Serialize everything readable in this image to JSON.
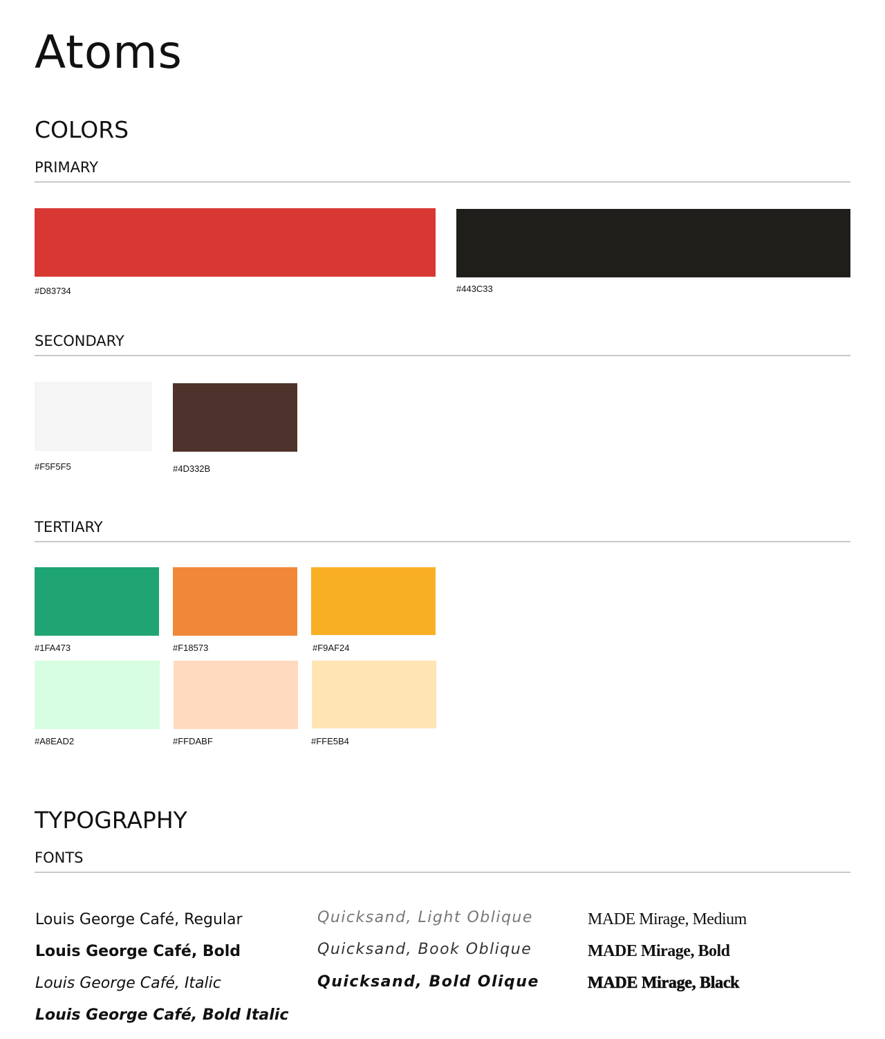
{
  "page": {
    "title": "Atoms"
  },
  "colors": {
    "heading": "COLORS",
    "primary": {
      "label": "PRIMARY",
      "swatches": [
        {
          "hex": "#D83734",
          "color": "#D83734"
        },
        {
          "hex": "#443C33",
          "color": "#201E1A"
        }
      ]
    },
    "secondary": {
      "label": "SECONDARY",
      "swatches": [
        {
          "hex": "#F5F5F5",
          "color": "#F5F5F5"
        },
        {
          "hex": "#4D332B",
          "color": "#4D332B"
        }
      ]
    },
    "tertiary": {
      "label": "TERTIARY",
      "swatches": [
        {
          "hex": "#1FA473",
          "color": "#1FA473"
        },
        {
          "hex": "#F18573",
          "color": "#F18739"
        },
        {
          "hex": "#F9AF24",
          "color": "#F9AF24"
        },
        {
          "hex": "#A8EAD2",
          "color": "#D7FEE0"
        },
        {
          "hex": "#FFDABF",
          "color": "#FFDABF"
        },
        {
          "hex": "#FFE5B4",
          "color": "#FFE5B4"
        }
      ]
    }
  },
  "typography": {
    "heading": "TYPOGRAPHY",
    "fonts_label": "FONTS",
    "louis_george": [
      "Louis George Café, Regular",
      "Louis George Café, Bold",
      "Louis George Café, Italic",
      "Louis George Café, Bold Italic"
    ],
    "quicksand": [
      "Quicksand, Light Oblique",
      "Quicksand, Book Oblique",
      "Quicksand, Bold Olique"
    ],
    "made_mirage": [
      "MADE Mirage, Medium",
      "MADE Mirage, Bold",
      "MADE Mirage, Black"
    ]
  }
}
